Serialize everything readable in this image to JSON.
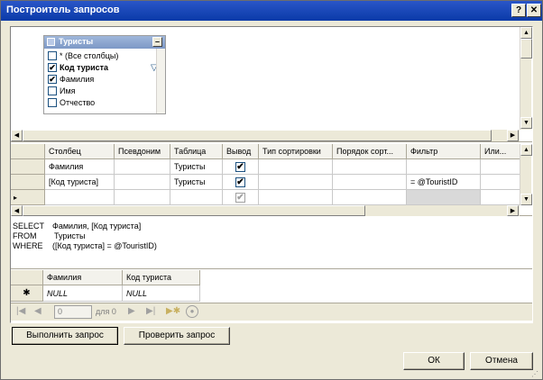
{
  "window": {
    "title": "Построитель запросов",
    "help_label": "?",
    "close_label": "✕"
  },
  "diagram": {
    "table_box": {
      "title": "Туристы",
      "minimize_label": "–",
      "items": [
        {
          "label": "* (Все столбцы)",
          "checked": false,
          "bold": false,
          "filter": false
        },
        {
          "label": "Код туриста",
          "checked": true,
          "bold": true,
          "filter": true
        },
        {
          "label": "Фамилия",
          "checked": true,
          "bold": false,
          "filter": false
        },
        {
          "label": "Имя",
          "checked": false,
          "bold": false,
          "filter": false
        },
        {
          "label": "Отчество",
          "checked": false,
          "bold": false,
          "filter": false
        }
      ]
    }
  },
  "grid": {
    "columns": [
      "Столбец",
      "Псевдоним",
      "Таблица",
      "Вывод",
      "Тип сортировки",
      "Порядок сорт...",
      "Фильтр",
      "Или..."
    ],
    "rows": [
      {
        "column": "Фамилия",
        "alias": "",
        "table": "Туристы",
        "output": true,
        "sort_type": "",
        "sort_order": "",
        "filter": ""
      },
      {
        "column": "[Код туриста]",
        "alias": "",
        "table": "Туристы",
        "output": true,
        "sort_type": "",
        "sort_order": "",
        "filter": "= @TouristID"
      },
      {
        "column": "",
        "alias": "",
        "table": "",
        "output": true,
        "sort_type": "",
        "sort_order": "",
        "filter": ""
      }
    ]
  },
  "sql": {
    "lines": [
      {
        "keyword": "SELECT",
        "text": "Фамилия, [Код туриста]"
      },
      {
        "keyword": "FROM",
        "text": "Туристы"
      },
      {
        "keyword": "WHERE",
        "text": "([Код туриста] = @TouristID)"
      }
    ]
  },
  "results": {
    "columns": [
      "Фамилия",
      "Код туриста"
    ],
    "rows": [
      [
        "NULL",
        "NULL"
      ]
    ],
    "new_row_marker": "✱",
    "nav": {
      "current": "0",
      "of_label": "для 0"
    }
  },
  "buttons": {
    "execute": "Выполнить запрос",
    "verify": "Проверить запрос",
    "ok": "ОК",
    "cancel": "Отмена"
  }
}
